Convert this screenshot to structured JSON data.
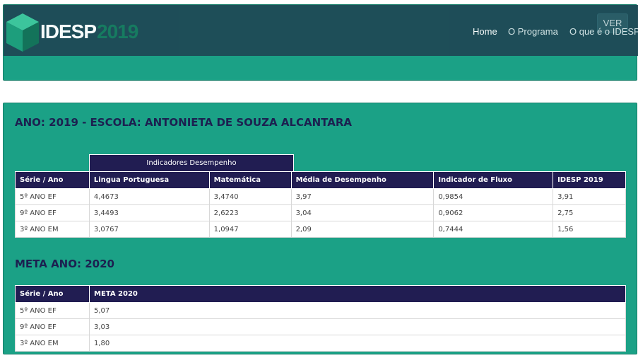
{
  "brand": {
    "name": "IDESP",
    "year": "2019"
  },
  "nav": {
    "ver_label": "VER",
    "links": [
      "Home",
      "O Programa",
      "O que é o IDESP"
    ]
  },
  "section_school": {
    "heading": "ANO: 2019 - ESCOLA: ANTONIETA DE SOUZA ALCANTARA",
    "group_header": "Indicadores Desempenho",
    "columns": [
      "Série / Ano",
      "Lingua Portuguesa",
      "Matemática",
      "Média de Desempenho",
      "Indicador de Fluxo",
      "IDESP 2019"
    ],
    "rows": [
      [
        "5º ANO EF",
        "4,4673",
        "3,4740",
        "3,97",
        "0,9854",
        "3,91"
      ],
      [
        "9º ANO EF",
        "3,4493",
        "2,6223",
        "3,04",
        "0,9062",
        "2,75"
      ],
      [
        "3º ANO EM",
        "3,0767",
        "1,0947",
        "2,09",
        "0,7444",
        "1,56"
      ]
    ]
  },
  "section_meta": {
    "heading": "META ANO: 2020",
    "columns": [
      "Série / Ano",
      "META 2020"
    ],
    "rows": [
      [
        "5º ANO EF",
        "5,07"
      ],
      [
        "9º ANO EF",
        "3,03"
      ],
      [
        "3º ANO EM",
        "1,80"
      ]
    ]
  },
  "colors": {
    "panel_green": "#1ba186",
    "navbar": "#1f4b57",
    "table_header": "#211d52",
    "heading_text": "#1c2050"
  },
  "icons": {
    "logo": "cube-logo-icon"
  }
}
